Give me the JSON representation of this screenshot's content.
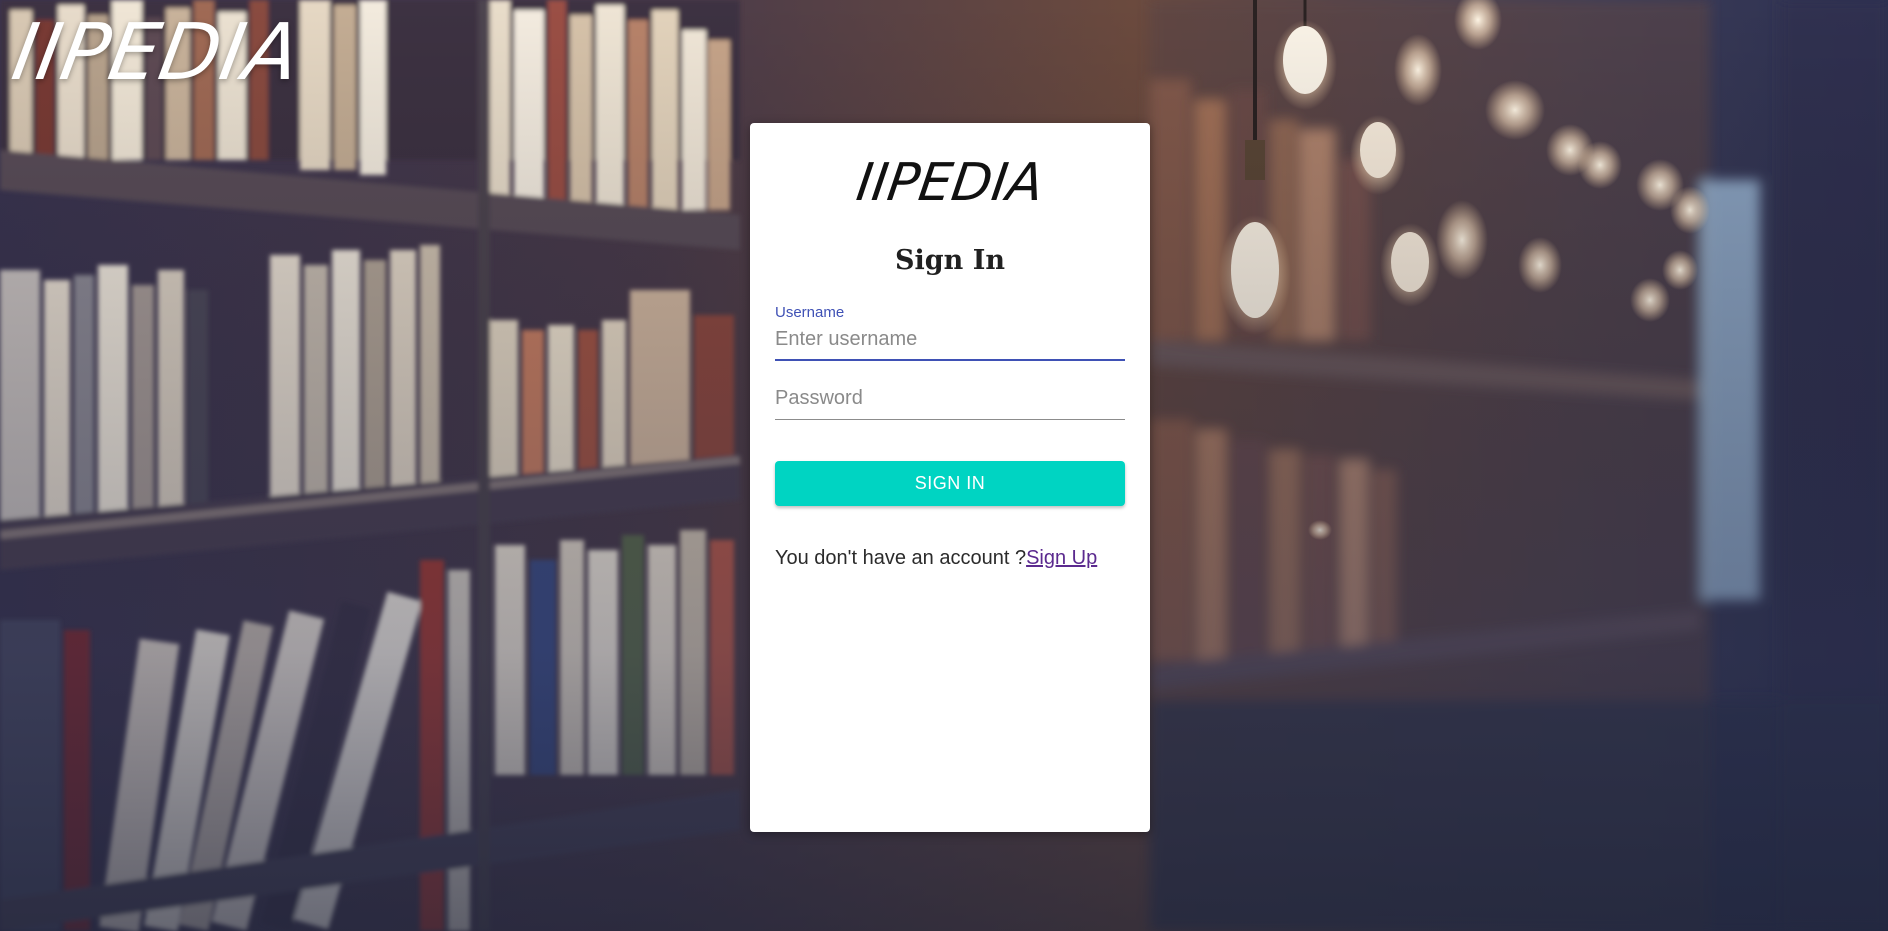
{
  "header": {
    "logo_text": "IIPEDIA"
  },
  "login_card": {
    "logo_text": "IIPEDIA",
    "title": "Sign In",
    "username": {
      "label": "Username",
      "placeholder": "Enter username",
      "value": ""
    },
    "password": {
      "placeholder": "Password",
      "value": ""
    },
    "submit_label": "SIGN IN",
    "account_prompt": "You don't have an account ?",
    "signup_link": "Sign Up"
  },
  "colors": {
    "accent": "#3f51b5",
    "button": "#00d4c2",
    "link": "#5b2a8f",
    "card_background": "#ffffff"
  }
}
